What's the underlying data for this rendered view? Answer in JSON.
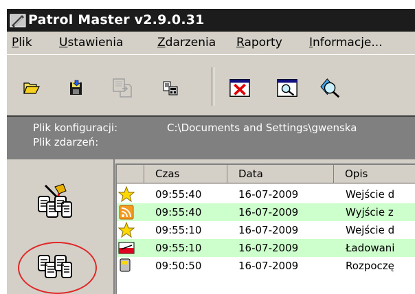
{
  "window": {
    "title": "Patrol Master v2.9.0.31"
  },
  "menu": [
    {
      "label": "Plik",
      "underline": "P",
      "rest": "lik"
    },
    {
      "label": "Ustawienia",
      "underline": "U",
      "rest": "stawienia"
    },
    {
      "label": "Zdarzenia",
      "underline": "Z",
      "rest": "darzenia"
    },
    {
      "label": "Raporty",
      "underline": "R",
      "rest": "aporty"
    },
    {
      "label": "Informacje...",
      "underline": "I",
      "rest": "nformacje..."
    }
  ],
  "toolbar": {
    "buttons": [
      {
        "icon": "open-folder-icon"
      },
      {
        "icon": "save-disk-icon"
      },
      {
        "icon": "copy-document-icon"
      },
      {
        "icon": "device-read-icon"
      },
      {
        "icon": "delete-events-icon"
      },
      {
        "icon": "view-search-icon"
      },
      {
        "icon": "find-zoom-icon"
      }
    ]
  },
  "info": {
    "config_label": "Plik konfiguracji:",
    "config_value": "C:\\Documents and Settings\\gwenska",
    "events_label": "Plik zdarzeń:",
    "events_value": ""
  },
  "left_panel": {
    "buttons": [
      {
        "icon": "reader-configure-icon"
      },
      {
        "icon": "reader-connect-icon"
      }
    ]
  },
  "table": {
    "columns": [
      "Czas",
      "Data",
      "Opis"
    ],
    "rows": [
      {
        "icon": "star-icon",
        "time": "09:55:40",
        "date": "16-07-2009",
        "desc": "Wejście d",
        "highlight": false
      },
      {
        "icon": "rss-orange-icon",
        "time": "09:55:40",
        "date": "16-07-2009",
        "desc": "Wyjście z",
        "highlight": true
      },
      {
        "icon": "star-icon",
        "time": "09:55:10",
        "date": "16-07-2009",
        "desc": "Wejście d",
        "highlight": false
      },
      {
        "icon": "flag-poland-icon",
        "time": "09:55:10",
        "date": "16-07-2009",
        "desc": "Ładowani",
        "highlight": true
      },
      {
        "icon": "device-icon",
        "time": "09:50:50",
        "date": "16-07-2009",
        "desc": "Rozpoczę",
        "highlight": false
      }
    ]
  },
  "colors": {
    "titlebar": "#1c1c1c",
    "chrome": "#d4d0c8",
    "infobar": "#808080",
    "row_highlight": "#ccffcc",
    "annotation_circle": "#e02828"
  }
}
